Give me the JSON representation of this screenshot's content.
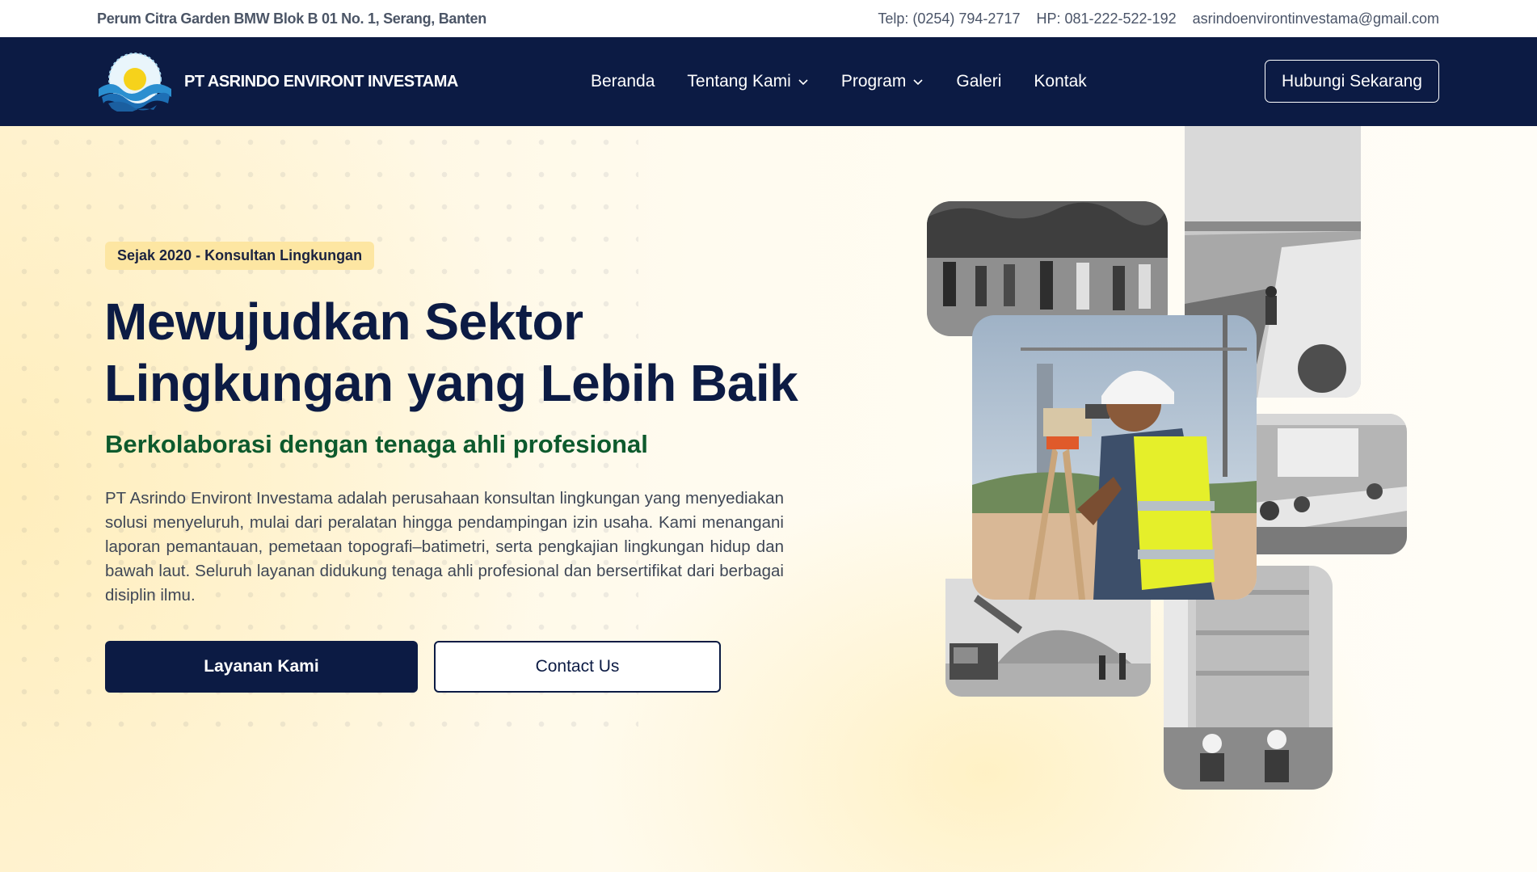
{
  "topbar": {
    "address": "Perum Citra Garden BMW Blok B 01 No. 1, Serang, Banten",
    "phone": "Telp: (0254) 794-2717",
    "mobile": "HP: 081-222-522-192",
    "email": "asrindoenvirontinvestama@gmail.com"
  },
  "navbar": {
    "brand_name": "PT ASRINDO ENVIRONT INVESTAMA",
    "logo_icon": "wave-sun-logo",
    "menu": [
      {
        "label": "Beranda",
        "has_dropdown": false
      },
      {
        "label": "Tentang Kami",
        "has_dropdown": true
      },
      {
        "label": "Program",
        "has_dropdown": true
      },
      {
        "label": "Galeri",
        "has_dropdown": false
      },
      {
        "label": "Kontak",
        "has_dropdown": false
      }
    ],
    "cta_label": "Hubungi Sekarang"
  },
  "hero": {
    "badge": "Sejak 2020 - Konsultan Lingkungan",
    "headline_line1": "Mewujudkan Sektor",
    "headline_line2": "Lingkungan yang Lebih Baik",
    "subheadline": "Berkolaborasi dengan tenaga ahli profesional",
    "description": "PT Asrindo Environt Investama adalah perusahaan konsultan lingkungan yang menyediakan solusi menyeluruh, mulai dari peralatan hingga pendampingan izin usaha. Kami menangani laporan pemantauan, pemetaan topografi–batimetri, serta pengkajian lingkungan hidup dan bawah laut. Seluruh layanan didukung tenaga ahli profesional dan bersertifikat dari berbagai disiplin ilmu.",
    "primary_button": "Layanan Kami",
    "secondary_button": "Contact Us"
  },
  "colors": {
    "navy": "#0c1b44",
    "green": "#0d5a2d",
    "badge_bg": "#fde6a2",
    "hero_bg": "#fff6dc"
  }
}
